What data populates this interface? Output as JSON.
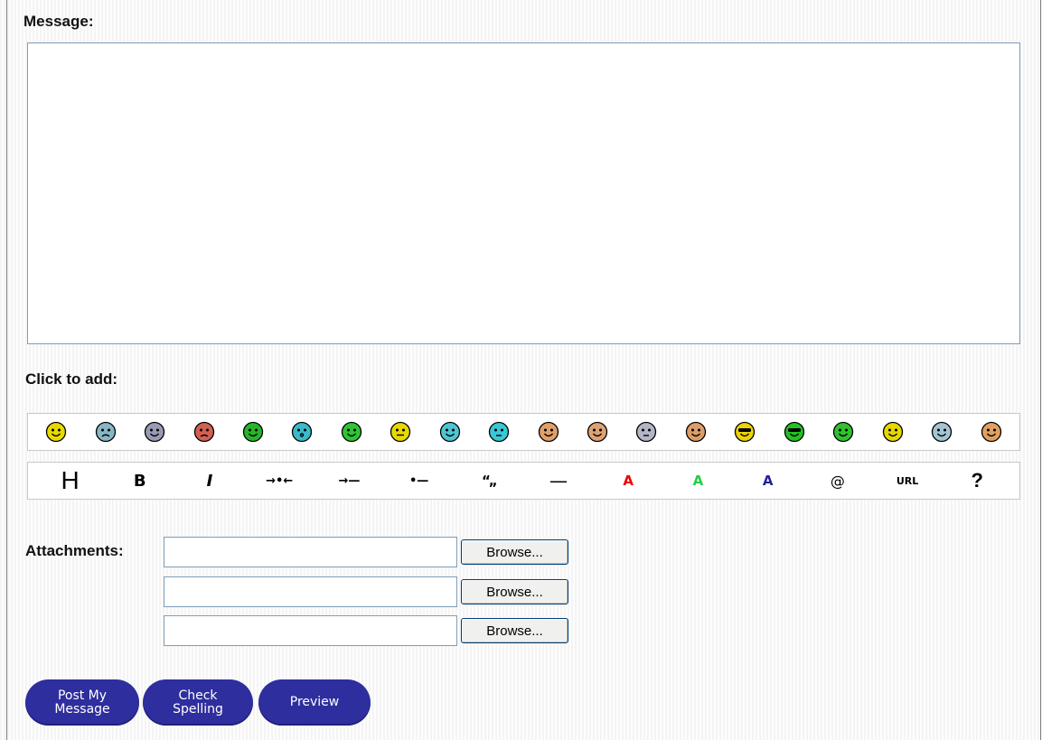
{
  "message": {
    "label": "Message:",
    "value": ""
  },
  "smilies": {
    "label": "Click to add:",
    "items": [
      {
        "name": "smile",
        "color": "#e8d900"
      },
      {
        "name": "sad",
        "color": "#87b6c4"
      },
      {
        "name": "grin",
        "color": "#9a9ab4"
      },
      {
        "name": "angry",
        "color": "#d26050"
      },
      {
        "name": "wink",
        "color": "#28b428"
      },
      {
        "name": "surprised",
        "color": "#3ab9c8"
      },
      {
        "name": "content",
        "color": "#2ec436"
      },
      {
        "name": "neutral",
        "color": "#e6d800"
      },
      {
        "name": "goggle",
        "color": "#4ec5d2"
      },
      {
        "name": "confused",
        "color": "#38c8d4"
      },
      {
        "name": "blush",
        "color": "#e0a068"
      },
      {
        "name": "eek",
        "color": "#dca272"
      },
      {
        "name": "sleepy",
        "color": "#b4b4c8"
      },
      {
        "name": "crazy",
        "color": "#dc9e68"
      },
      {
        "name": "cool",
        "color": "#ecd400"
      },
      {
        "name": "cool-green",
        "color": "#22c022"
      },
      {
        "name": "sick",
        "color": "#30c030"
      },
      {
        "name": "tongue",
        "color": "#e6d800"
      },
      {
        "name": "grimace",
        "color": "#a4c4d4"
      },
      {
        "name": "big-grin",
        "color": "#e0a060"
      }
    ]
  },
  "format_toolbar": [
    {
      "name": "heading",
      "label": "H",
      "cls": "h",
      "color": "#000000"
    },
    {
      "name": "bold",
      "label": "B",
      "cls": "b",
      "color": "#000000"
    },
    {
      "name": "italic",
      "label": "I",
      "cls": "i",
      "color": "#000000"
    },
    {
      "name": "center",
      "label": "→•←",
      "cls": "sym",
      "color": "#000000"
    },
    {
      "name": "indent",
      "label": "→—",
      "cls": "sym",
      "color": "#000000"
    },
    {
      "name": "bullet",
      "label": "•—",
      "cls": "sym",
      "color": "#000000"
    },
    {
      "name": "quote",
      "label": "“„",
      "cls": "quote",
      "color": "#000000"
    },
    {
      "name": "horizontal-rule",
      "label": "—",
      "cls": "line",
      "color": "#000000"
    },
    {
      "name": "red-text",
      "label": "A",
      "cls": "col",
      "color": "#ee0000"
    },
    {
      "name": "green-text",
      "label": "A",
      "cls": "col",
      "color": "#22cc44"
    },
    {
      "name": "blue-text",
      "label": "A",
      "cls": "col",
      "color": "#222299"
    },
    {
      "name": "email",
      "label": "@",
      "cls": "at",
      "color": "#000000"
    },
    {
      "name": "url",
      "label": "URL",
      "cls": "url",
      "color": "#000000"
    },
    {
      "name": "help",
      "label": "?",
      "cls": "help",
      "color": "#000000"
    }
  ],
  "attachments": {
    "label": "Attachments:",
    "browse_label": "Browse..."
  },
  "actions": {
    "post": "Post My\nMessage",
    "spell": "Check\nSpelling",
    "preview": "Preview"
  },
  "colors": {
    "button_bg": "#2e2e9e",
    "field_border": "#7f9db9"
  }
}
